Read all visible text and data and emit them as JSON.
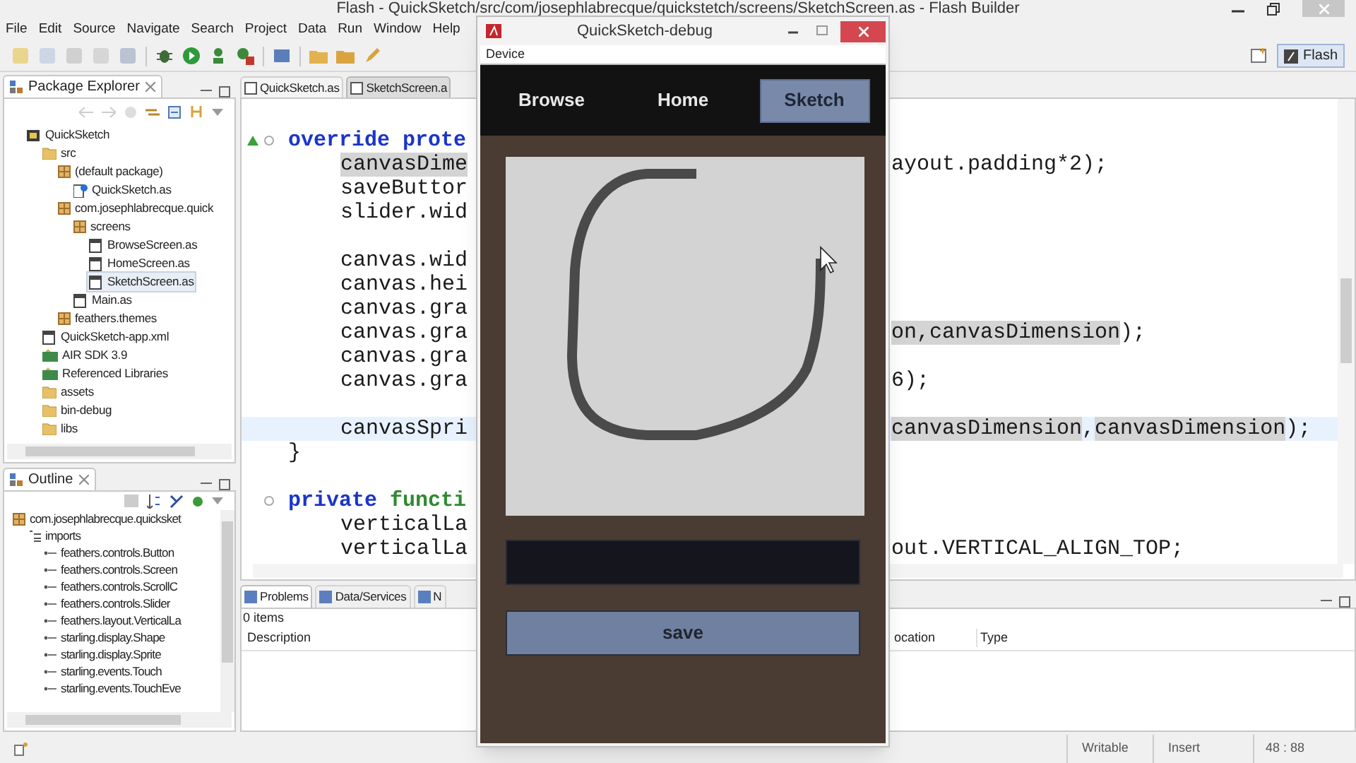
{
  "window": {
    "title": "Flash - QuickSketch/src/com/josephlabrecque/quickstetch/screens/SketchScreen.as - Flash Builder"
  },
  "menu": [
    "File",
    "Edit",
    "Source",
    "Navigate",
    "Search",
    "Project",
    "Data",
    "Run",
    "Window",
    "Help"
  ],
  "perspective": {
    "label": "Flash",
    "selected": true
  },
  "package_explorer": {
    "title": "Package Explorer",
    "tree": [
      {
        "label": "QuickSketch",
        "kind": "project",
        "selected": false,
        "children": [
          {
            "label": "src",
            "kind": "source",
            "selected": false,
            "children": [
              {
                "label": "(default package)",
                "kind": "package",
                "selected": false,
                "children": [
                  {
                    "label": "QuickSketch.as",
                    "kind": "main",
                    "selected": false
                  }
                ]
              },
              {
                "label": "com.josephlabrecque.quick",
                "kind": "package",
                "selected": false,
                "children": [
                  {
                    "label": "screens",
                    "kind": "package",
                    "selected": false,
                    "children": [
                      {
                        "label": "BrowseScreen.as",
                        "kind": "file",
                        "selected": false
                      },
                      {
                        "label": "HomeScreen.as",
                        "kind": "file",
                        "selected": false
                      },
                      {
                        "label": "SketchScreen.as",
                        "kind": "file",
                        "selected": true
                      }
                    ]
                  },
                  {
                    "label": "Main.as",
                    "kind": "file",
                    "selected": false
                  }
                ]
              },
              {
                "label": "feathers.themes",
                "kind": "package",
                "selected": false
              }
            ]
          },
          {
            "label": "QuickSketch-app.xml",
            "kind": "file",
            "selected": false
          },
          {
            "label": "AIR SDK 3.9",
            "kind": "library",
            "selected": false
          },
          {
            "label": "Referenced Libraries",
            "kind": "library",
            "selected": false
          },
          {
            "label": "assets",
            "kind": "folder",
            "selected": false
          },
          {
            "label": "bin-debug",
            "kind": "folder",
            "selected": false
          },
          {
            "label": "libs",
            "kind": "folder",
            "selected": false
          }
        ]
      }
    ]
  },
  "outline": {
    "title": "Outline",
    "tree": [
      {
        "label": "com.josephlabrecque.quicksket",
        "kind": "package",
        "children": [
          {
            "label": "imports",
            "kind": "imports",
            "children": [
              {
                "label": "feathers.controls.Button",
                "kind": "import"
              },
              {
                "label": "feathers.controls.Screen",
                "kind": "import"
              },
              {
                "label": "feathers.controls.ScrollC",
                "kind": "import"
              },
              {
                "label": "feathers.controls.Slider",
                "kind": "import"
              },
              {
                "label": "feathers.layout.VerticalLa",
                "kind": "import"
              },
              {
                "label": "starling.display.Shape",
                "kind": "import"
              },
              {
                "label": "starling.display.Sprite",
                "kind": "import"
              },
              {
                "label": "starling.events.Touch",
                "kind": "import"
              },
              {
                "label": "starling.events.TouchEve",
                "kind": "import"
              }
            ]
          }
        ]
      }
    ]
  },
  "editor_tabs": [
    {
      "label": "QuickSketch.as",
      "selected": false
    },
    {
      "label": "SketchScreen.a",
      "selected": true
    }
  ],
  "code": [
    {
      "kind": "override-method",
      "current": false,
      "segments": [
        {
          "text": "override prote",
          "kind": "keyword"
        }
      ],
      "children": [
        {
          "kind": "code",
          "current": false,
          "segments": [
            {
              "text": "canvasDime",
              "kind": "occurrence"
            }
          ],
          "right": [
            {
              "text": "ayout.padding*2);",
              "kind": "plain"
            }
          ]
        },
        {
          "kind": "code",
          "current": false,
          "segments": [
            {
              "text": "saveButtor",
              "kind": "plain"
            }
          ]
        },
        {
          "kind": "code",
          "current": false,
          "segments": [
            {
              "text": "slider.wid",
              "kind": "plain"
            }
          ]
        },
        {
          "kind": "blank",
          "current": false
        },
        {
          "kind": "code",
          "current": false,
          "segments": [
            {
              "text": "canvas.wid",
              "kind": "plain"
            }
          ]
        },
        {
          "kind": "code",
          "current": false,
          "segments": [
            {
              "text": "canvas.hei",
              "kind": "plain"
            }
          ]
        },
        {
          "kind": "code",
          "current": false,
          "segments": [
            {
              "text": "canvas.gra",
              "kind": "plain"
            }
          ]
        },
        {
          "kind": "code",
          "current": false,
          "segments": [
            {
              "text": "canvas.gra",
              "kind": "plain"
            }
          ],
          "right": [
            {
              "text": "on,",
              "kind": "occurrence"
            },
            {
              "text": "canvasDimension",
              "kind": "occurrence"
            },
            {
              "text": ");",
              "kind": "plain"
            }
          ]
        },
        {
          "kind": "code",
          "current": false,
          "segments": [
            {
              "text": "canvas.gra",
              "kind": "plain"
            }
          ]
        },
        {
          "kind": "code",
          "current": false,
          "segments": [
            {
              "text": "canvas.gra",
              "kind": "plain"
            }
          ],
          "right": [
            {
              "text": "6);",
              "kind": "plain"
            }
          ]
        },
        {
          "kind": "blank",
          "current": false
        },
        {
          "kind": "code",
          "current": true,
          "segments": [
            {
              "text": "canvasSpri",
              "kind": "plain"
            }
          ],
          "right": [
            {
              "text": "canvasDimension",
              "kind": "occurrence"
            },
            {
              "text": ",",
              "kind": "plain"
            },
            {
              "text": "canvasDimension",
              "kind": "occurrence"
            },
            {
              "text": ");",
              "kind": "plain"
            }
          ]
        }
      ]
    },
    {
      "kind": "code",
      "current": false,
      "segments": [
        {
          "text": "}",
          "kind": "plain"
        }
      ]
    },
    {
      "kind": "blank",
      "current": false
    },
    {
      "kind": "method",
      "current": false,
      "segments": [
        {
          "text": "private",
          "kind": "keyword"
        },
        {
          "text": "functi",
          "kind": "function"
        }
      ],
      "children": [
        {
          "kind": "code",
          "current": false,
          "segments": [
            {
              "text": "verticalLa",
              "kind": "plain"
            }
          ]
        },
        {
          "kind": "code",
          "current": false,
          "segments": [
            {
              "text": "verticalLa",
              "kind": "plain"
            }
          ],
          "right": [
            {
              "text": "out.VERTICAL_ALIGN_TOP;",
              "kind": "plain"
            }
          ]
        }
      ]
    }
  ],
  "bottom_panel": {
    "tabs": [
      {
        "label": "Problems",
        "selected": true
      },
      {
        "label": "Data/Services",
        "selected": false
      },
      {
        "label": "N",
        "selected": false
      }
    ],
    "count": "0 items",
    "columns": [
      "Description",
      "ocation",
      "Type"
    ]
  },
  "status_bar": [
    "Writable",
    "Insert",
    "48 : 88"
  ],
  "debug_window": {
    "title": "QuickSketch-debug",
    "menu": [
      "Device"
    ],
    "nav_tabs": [
      {
        "label": "Browse",
        "selected": false
      },
      {
        "label": "Home",
        "selected": false
      },
      {
        "label": "Sketch",
        "selected": true
      }
    ],
    "save_button": "save"
  }
}
